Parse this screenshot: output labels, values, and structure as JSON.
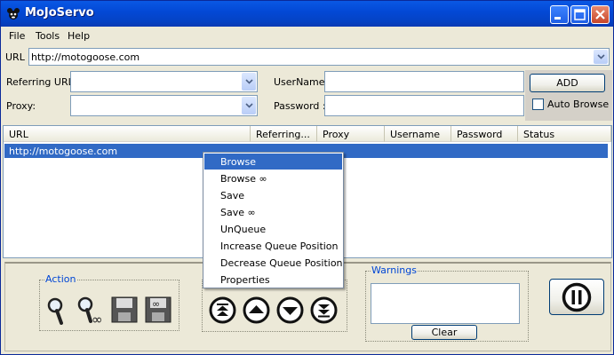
{
  "window": {
    "title": "MoJoServo"
  },
  "menu": [
    "File",
    "Tools",
    "Help"
  ],
  "url_row": {
    "label": "URL :",
    "value": "http://motogoose.com"
  },
  "form": {
    "referring_label": "Referring URL:",
    "proxy_label": "Proxy:",
    "username_label": "UserName :",
    "password_label": "Password :",
    "add_button": "ADD",
    "auto_browse_label": "Auto Browse",
    "auto_browse_checked": false
  },
  "table": {
    "columns": [
      "URL",
      "Referring...",
      "Proxy",
      "Username",
      "Password",
      "Status"
    ],
    "rows": [
      {
        "url": "http://motogoose.com",
        "selected": true
      }
    ]
  },
  "context_menu": {
    "items": [
      "Browse",
      "Browse ∞",
      "Save",
      "Save ∞",
      "UnQueue",
      "Increase Queue Position",
      "Decrease Queue Position",
      "Properties"
    ],
    "highlighted_index": 0
  },
  "action_group": {
    "title": "Action",
    "icons": [
      "browse-icon",
      "browse-infinite-icon",
      "save-icon",
      "save-infinite-icon"
    ]
  },
  "queue_group": {
    "icons": [
      "move-top-icon",
      "move-up-icon",
      "move-down-icon",
      "move-bottom-icon"
    ]
  },
  "warnings_group": {
    "title": "Warnings",
    "clear_button": "Clear"
  },
  "pause_button": {
    "icon": "pause-icon"
  }
}
